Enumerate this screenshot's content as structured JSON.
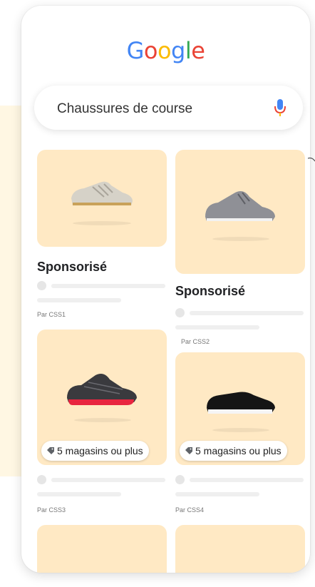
{
  "logo": {
    "letters": [
      "G",
      "o",
      "o",
      "g",
      "l",
      "e"
    ],
    "colors": [
      "#4285F4",
      "#EA4335",
      "#FBBC05",
      "#4285F4",
      "#34A853",
      "#EA4335"
    ]
  },
  "search": {
    "query": "Chaussures de course",
    "mic_icon": "mic-icon"
  },
  "products": [
    {
      "sponsored": "Sponsorisé",
      "seller": "Par CSS1",
      "image": "running-shoe-grey-white"
    },
    {
      "sponsored": "Sponsorisé",
      "seller": "Par CSS2",
      "image": "running-shoe-grey-knit"
    },
    {
      "badge": "5 magasins ou plus",
      "seller": "Par CSS3",
      "image": "running-shoe-black-red"
    },
    {
      "badge": "5 magasins ou plus",
      "seller": "Par CSS4",
      "image": "slip-on-shoe-black"
    }
  ],
  "colors": {
    "card_bg": "#ffe9c4",
    "accent_side_card": "#fff7e3"
  }
}
